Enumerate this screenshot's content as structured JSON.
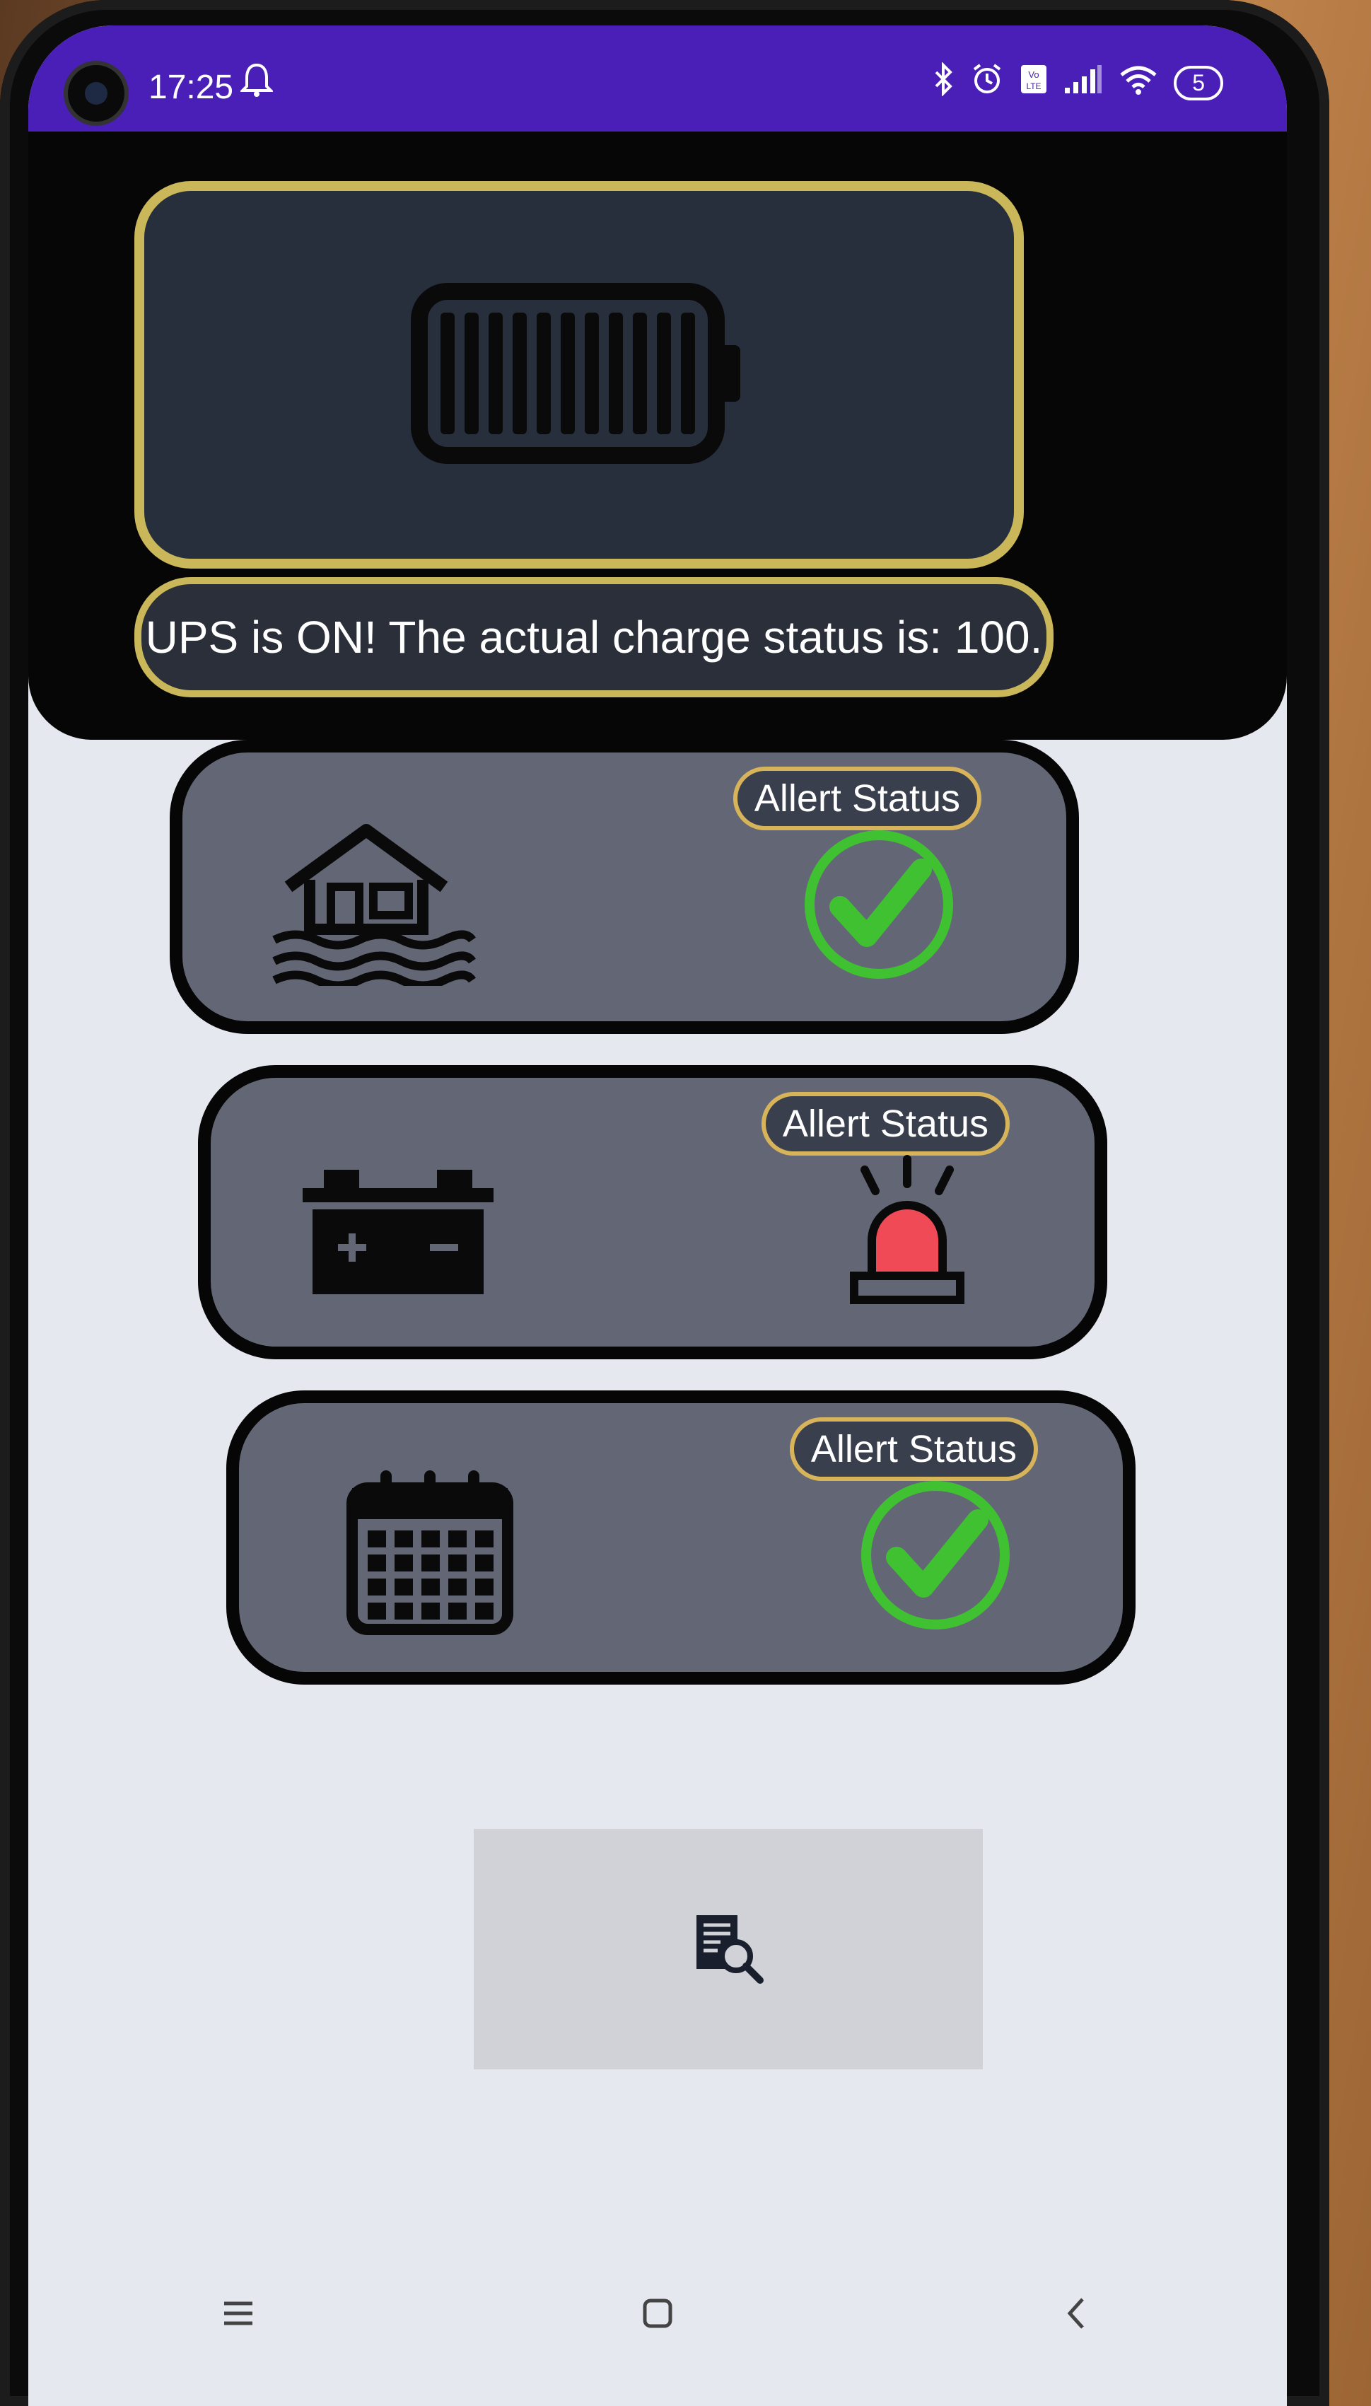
{
  "status_bar": {
    "time": "17:25",
    "bell_icon": "bell-icon",
    "battery_level": "5",
    "icons": [
      "bluetooth-icon",
      "alarm-icon",
      "volte-icon",
      "signal-icon",
      "wifi-icon"
    ]
  },
  "ups": {
    "status_text": "UPS is ON! The actual charge status is: 100.",
    "battery_icon": "battery-full-icon",
    "charge_percent": 100
  },
  "alerts": [
    {
      "label": "Allert Status",
      "left_icon": "flood-house-icon",
      "right_icon": "green-check-icon",
      "state": "ok"
    },
    {
      "label": "Allert Status",
      "left_icon": "car-battery-icon",
      "right_icon": "red-siren-icon",
      "state": "alarm"
    },
    {
      "label": "Allert Status",
      "left_icon": "calendar-icon",
      "right_icon": "green-check-icon",
      "state": "ok"
    }
  ],
  "report_button": {
    "icon": "document-search-icon"
  },
  "nav": {
    "menu_icon": "menu-icon",
    "home_icon": "home-square-icon",
    "back_icon": "back-chevron-icon"
  },
  "colors": {
    "status_bar": "#4a1fb8",
    "accent_gold": "#c9b75a",
    "card_gray": "#636775",
    "ok_green": "#3fc132",
    "alarm_red": "#ef4a55"
  }
}
